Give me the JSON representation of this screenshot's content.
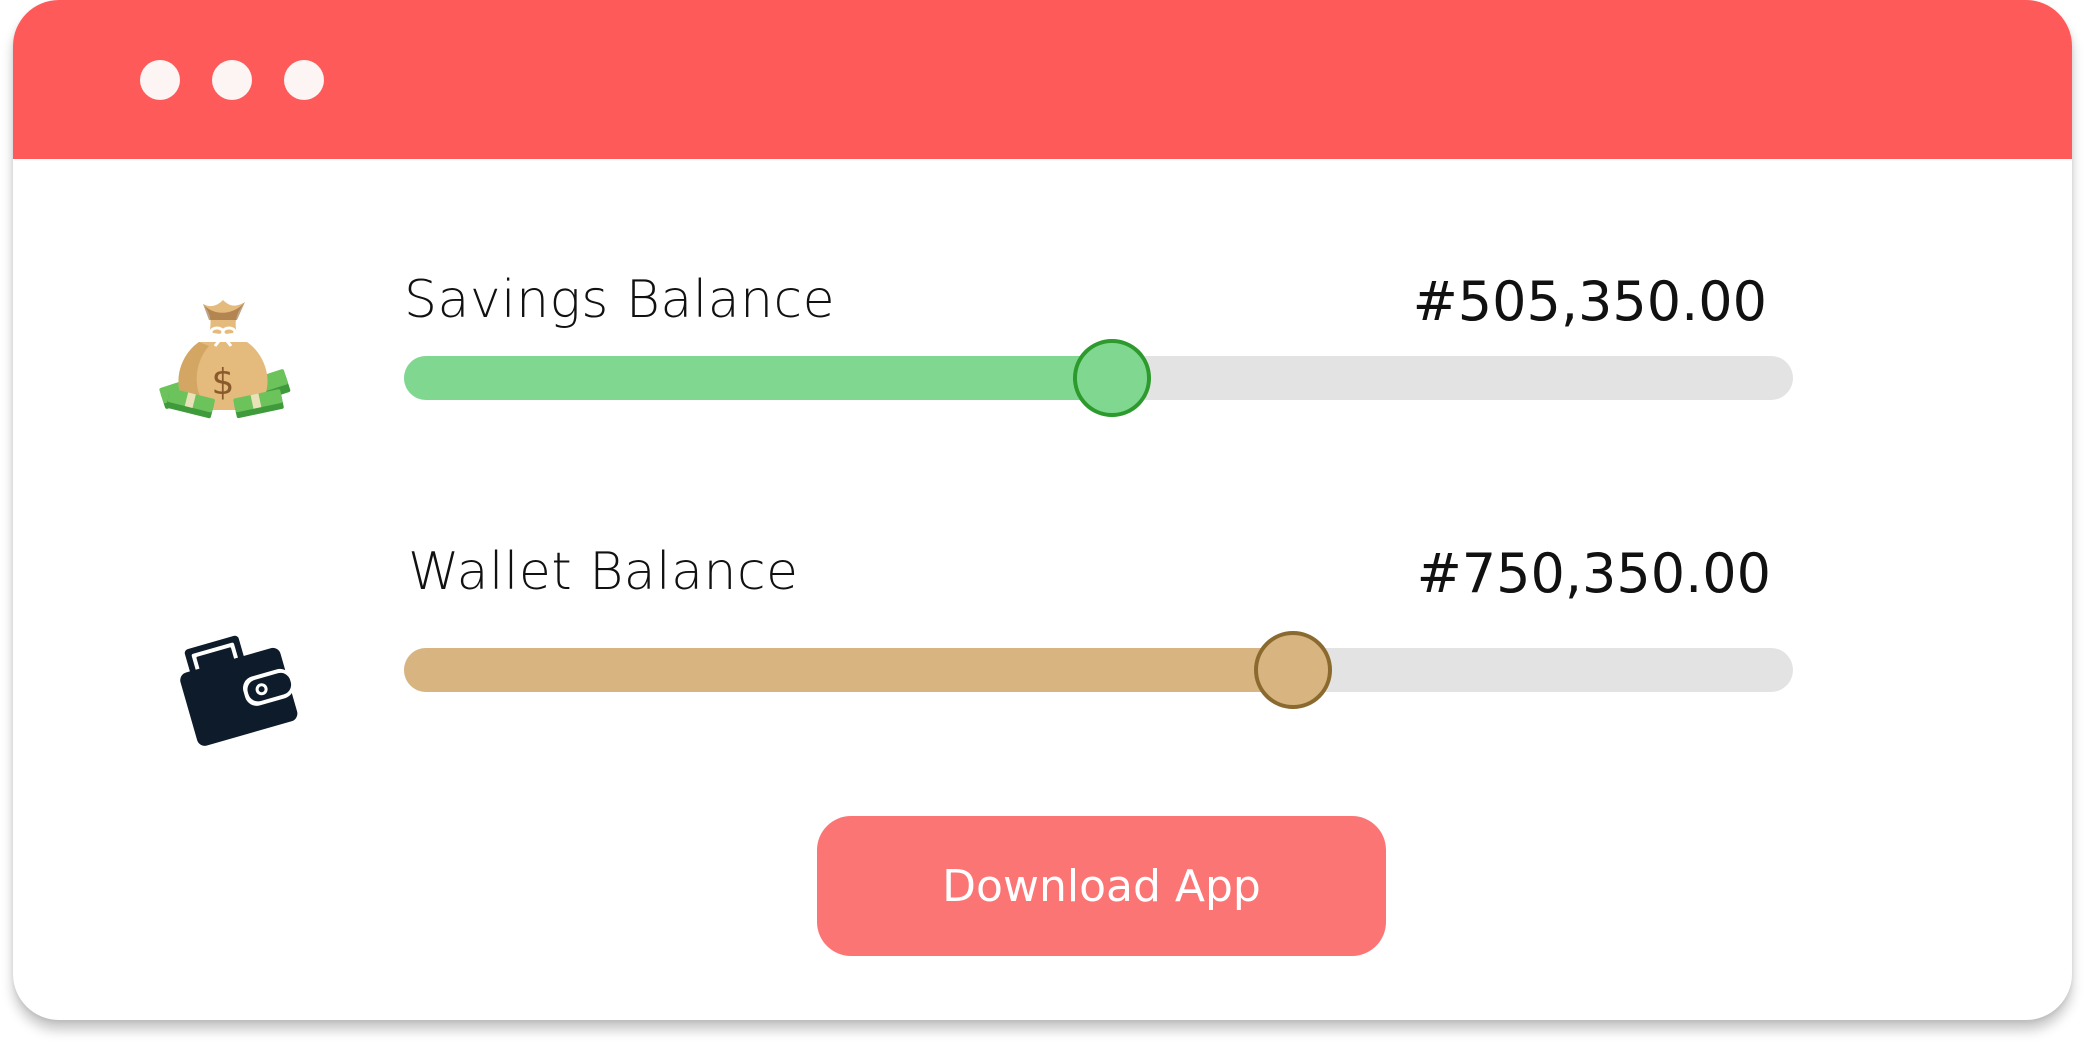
{
  "window": {
    "titlebar_color": "#fd5a59",
    "controls": [
      "window-dot-icon",
      "window-dot-icon",
      "window-dot-icon"
    ]
  },
  "balances": [
    {
      "label": "Savings Balance",
      "amount": "#505,350.00",
      "icon": "money-bag-icon",
      "level_percent": 51,
      "fill_color": "#80d890",
      "thumb_border_color": "#2c9a2c"
    },
    {
      "label": "Wallet Balance",
      "amount": "#750,350.00",
      "icon": "wallet-icon",
      "level_percent": 64,
      "fill_color": "#d8b480",
      "thumb_border_color": "#8a6a2e"
    }
  ],
  "actions": {
    "download_label": "Download App",
    "download_color": "#fc7575"
  }
}
